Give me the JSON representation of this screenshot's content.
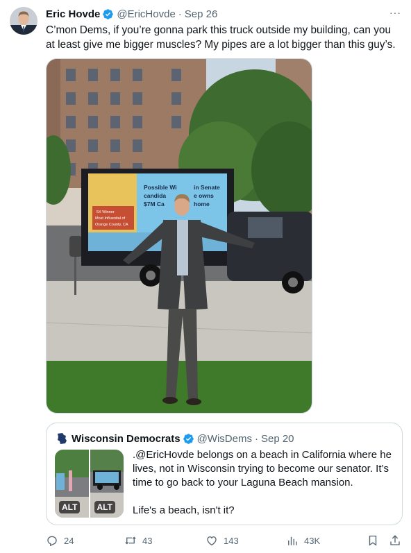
{
  "tweet": {
    "author_name": "Eric Hovde",
    "author_handle": "@EricHovde",
    "separator": "·",
    "date": "Sep 26",
    "more_label": "···",
    "text": "C’mon Dems, if you’re gonna park this truck outside my building, can you at least give me bigger muscles? My pipes are a lot bigger than this guy’s.",
    "media_sign": {
      "line1": "Possible Wi",
      "line1b": "in Senate",
      "line2": "candida",
      "line2b": "e owns",
      "line3": "$7M Ca",
      "line3b": "home",
      "tag1": "5X Winner",
      "tag2": "Most Influential of",
      "tag3": "Orange County, CA"
    }
  },
  "quote": {
    "author_name": "Wisconsin Democrats",
    "author_handle": "@WisDems",
    "separator": "·",
    "date": "Sep 20",
    "text_line1": ".@EricHovde belongs on a beach in California where he lives, not in Wisconsin trying to become our senator. It’s time to go back to your Laguna Beach mansion.",
    "text_line2": "Life's a beach, isn't it?",
    "alt_label": "ALT"
  },
  "actions": {
    "replies": "24",
    "reposts": "43",
    "likes": "143",
    "views": "43K"
  },
  "colors": {
    "verified": "#1d9bf0",
    "muted": "#536471",
    "border": "#cfd9de"
  }
}
